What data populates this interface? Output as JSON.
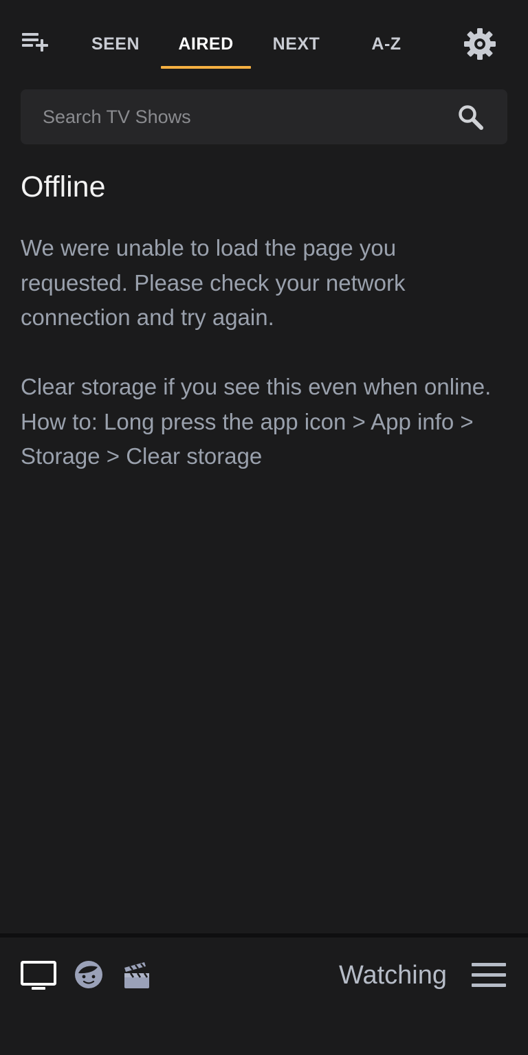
{
  "header": {
    "add_icon": "playlist-add-icon",
    "tabs": [
      {
        "label": "SEEN",
        "active": false
      },
      {
        "label": "AIRED",
        "active": true
      },
      {
        "label": "NEXT",
        "active": false
      },
      {
        "label": "A-Z",
        "active": false
      }
    ],
    "settings_icon": "gear-icon"
  },
  "search": {
    "placeholder": "Search TV Shows",
    "icon": "search-icon"
  },
  "content": {
    "title": "Offline",
    "message_1": "We were unable to load the page you requested. Please check your network connection and try again.",
    "message_2": "Clear storage if you see this even when online. How to: Long press the app icon > App info > Storage > Clear storage"
  },
  "bottom_nav": {
    "items": [
      {
        "icon": "tv-icon",
        "active": true
      },
      {
        "icon": "face-icon",
        "active": false
      },
      {
        "icon": "movie-clapper-icon",
        "active": false
      }
    ],
    "section_label": "Watching",
    "menu_icon": "hamburger-menu-icon"
  },
  "colors": {
    "background": "#1b1b1c",
    "accent": "#f5b041",
    "muted_text": "#9aa1ad",
    "search_background": "#262628"
  }
}
